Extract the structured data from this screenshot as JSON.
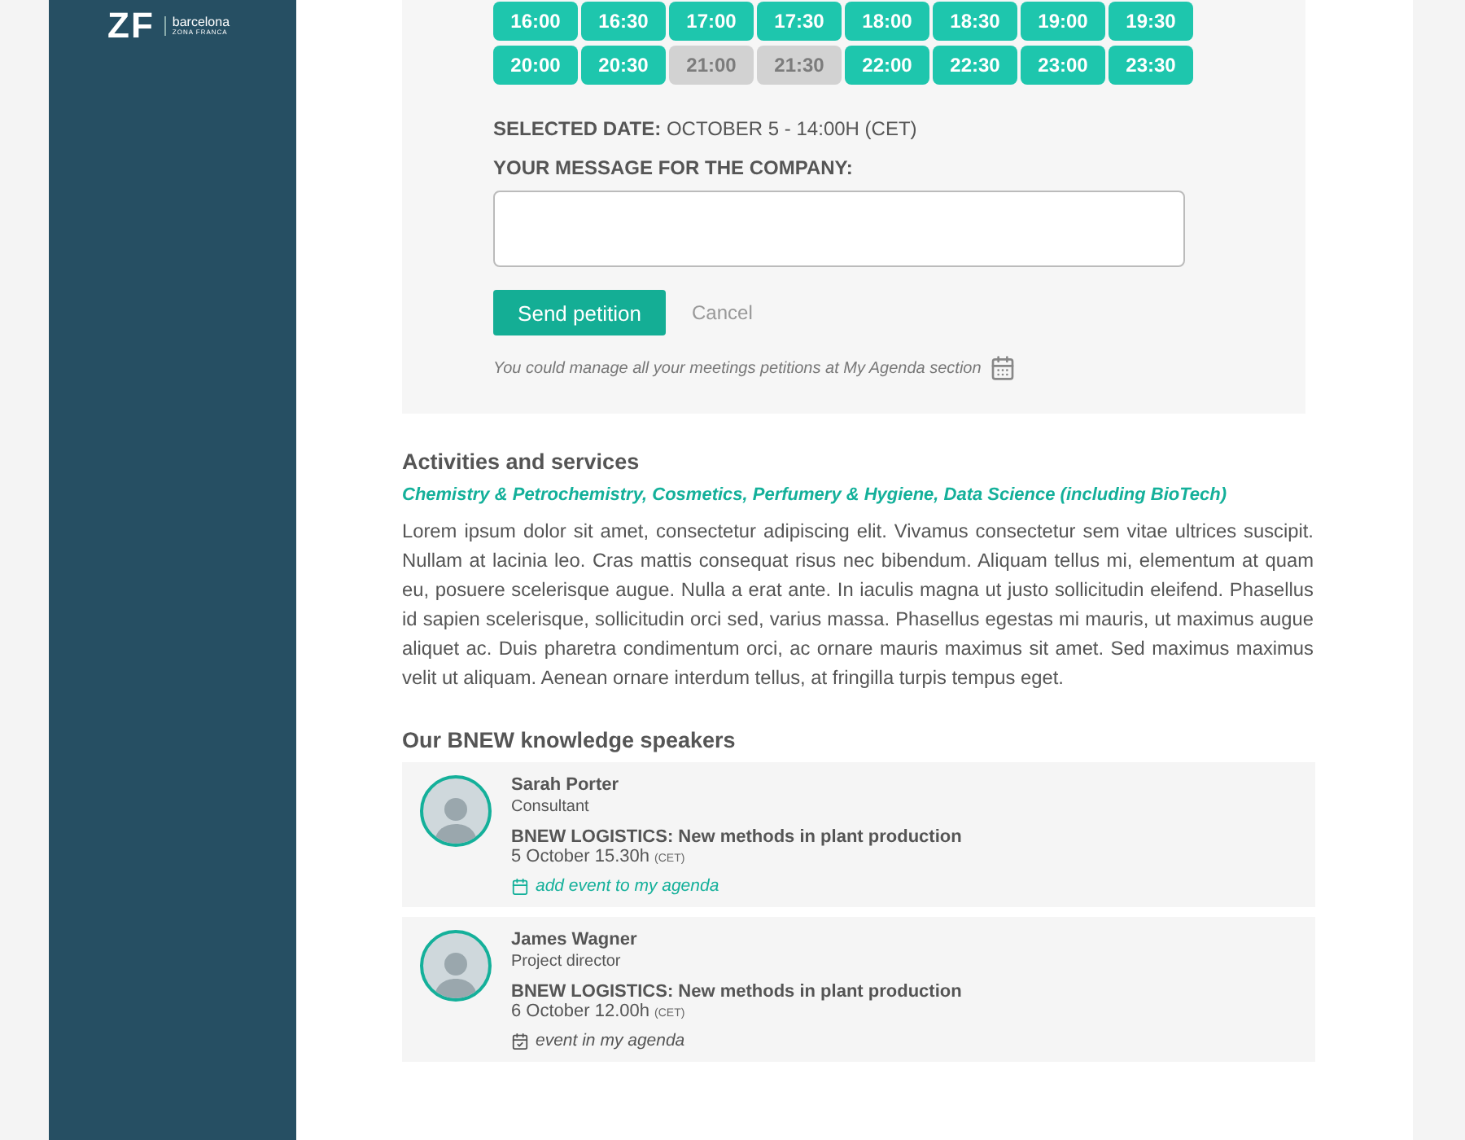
{
  "sidebar": {
    "logo": {
      "mark": "ZF",
      "name": "barcelona",
      "sub": "ZONA FRANCA"
    }
  },
  "booking": {
    "slots": [
      {
        "label": "16:00",
        "disabled": false
      },
      {
        "label": "16:30",
        "disabled": false
      },
      {
        "label": "17:00",
        "disabled": false
      },
      {
        "label": "17:30",
        "disabled": false
      },
      {
        "label": "18:00",
        "disabled": false
      },
      {
        "label": "18:30",
        "disabled": false
      },
      {
        "label": "19:00",
        "disabled": false
      },
      {
        "label": "19:30",
        "disabled": false
      },
      {
        "label": "20:00",
        "disabled": false
      },
      {
        "label": "20:30",
        "disabled": false
      },
      {
        "label": "21:00",
        "disabled": true
      },
      {
        "label": "21:30",
        "disabled": true
      },
      {
        "label": "22:00",
        "disabled": false
      },
      {
        "label": "22:30",
        "disabled": false
      },
      {
        "label": "23:00",
        "disabled": false
      },
      {
        "label": "23:30",
        "disabled": false
      }
    ],
    "selected_label": "SELECTED DATE:",
    "selected_value": "OCTOBER 5 - 14:00H (CET)",
    "message_label": "YOUR MESSAGE FOR THE COMPANY:",
    "send_button": "Send petition",
    "cancel_button": "Cancel",
    "note": "You could manage all your meetings petitions at My Agenda section"
  },
  "activities": {
    "title": "Activities and services",
    "tags": "Chemistry & Petrochemistry, Cosmetics, Perfumery & Hygiene, Data Science (including BioTech)",
    "description": "Lorem ipsum dolor sit amet, consectetur adipiscing elit. Vivamus consectetur sem vitae ultrices suscipit. Nullam at lacinia leo. Cras mattis consequat risus nec bibendum. Aliquam tellus mi, elementum at quam eu, posuere scelerisque augue. Nulla a erat ante. In iaculis magna ut justo sollicitudin eleifend. Phasellus id sapien scelerisque, sollicitudin orci sed, varius massa. Phasellus egestas mi mauris, ut maximus augue aliquet ac. Duis pharetra condimentum orci, ac ornare mauris maximus sit amet. Sed maximus maximus velit ut aliquam. Aenean ornare interdum tellus, at fringilla turpis tempus eget."
  },
  "speakers": {
    "title": "Our BNEW knowledge speakers",
    "items": [
      {
        "name": "Sarah Porter",
        "role": "Consultant",
        "event": "BNEW LOGISTICS: New methods in plant production",
        "date": "5 October 15.30h",
        "tz": "(CET)",
        "action": "add event to my agenda",
        "in_agenda": false
      },
      {
        "name": "James Wagner",
        "role": "Project director",
        "event": "BNEW LOGISTICS: New methods in plant production",
        "date": "6 October 12.00h",
        "tz": "(CET)",
        "action": "event in my agenda",
        "in_agenda": true
      }
    ]
  }
}
